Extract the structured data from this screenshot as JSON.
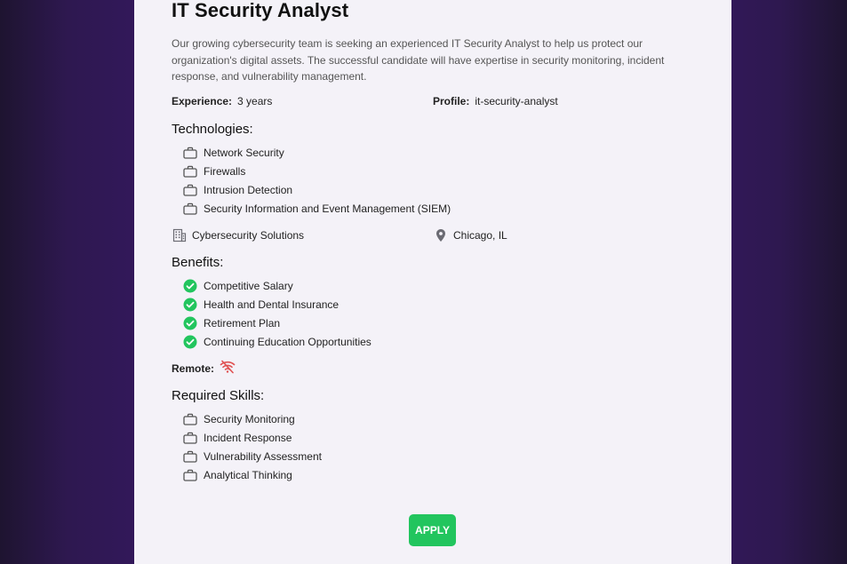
{
  "job": {
    "title": "IT Security Analyst",
    "description": "Our growing cybersecurity team is seeking an experienced IT Security Analyst to help us protect our organization's digital assets. The successful candidate will have expertise in security monitoring, incident response, and vulnerability management.",
    "experience_label": "Experience:",
    "experience_value": "3 years",
    "profile_label": "Profile:",
    "profile_value": "it-security-analyst",
    "technologies_heading": "Technologies:",
    "technologies": [
      "Network Security",
      "Firewalls",
      "Intrusion Detection",
      "Security Information and Event Management (SIEM)"
    ],
    "company": "Cybersecurity Solutions",
    "location": "Chicago, IL",
    "benefits_heading": "Benefits:",
    "benefits": [
      "Competitive Salary",
      "Health and Dental Insurance",
      "Retirement Plan",
      "Continuing Education Opportunities"
    ],
    "remote_label": "Remote:",
    "remote_icon": "wifi-off-icon",
    "skills_heading": "Required Skills:",
    "skills": [
      "Security Monitoring",
      "Incident Response",
      "Vulnerability Assessment",
      "Analytical Thinking"
    ],
    "apply_label": "APPLY"
  },
  "colors": {
    "accent": "#22c55e",
    "remote_off": "#e05252",
    "icon_gray": "#6b6b73"
  }
}
